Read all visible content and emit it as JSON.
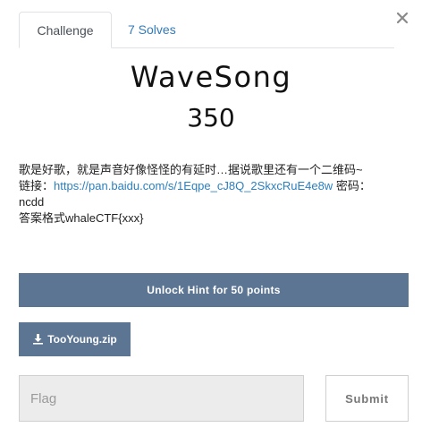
{
  "tabs": [
    {
      "label": "Challenge",
      "active": true
    },
    {
      "label": "7 Solves",
      "active": false
    }
  ],
  "close_icon": "close-icon",
  "challenge": {
    "name": "WaveSong",
    "points": "350",
    "description": {
      "line1": "歌是好歌，就是声音好像怪怪的有延时…据说歌里还有一个二维码~",
      "link_prefix": "链接：",
      "link_text": "https://pan.baidu.com/s/1Eqpe_cJ8Q_2SkxcRuE4e8w",
      "link_suffix": " 密码：",
      "password": "ncdd",
      "format": "答案格式whaleCTF{xxx}"
    }
  },
  "hint_button": {
    "label": "Unlock Hint for 50 points"
  },
  "file_button": {
    "label": "TooYoung.zip",
    "icon": "download-icon"
  },
  "flag_input": {
    "value": "",
    "placeholder": "Flag"
  },
  "submit_button": {
    "label": "Submit"
  },
  "colors": {
    "button_bg": "#5c7593",
    "link": "#2a7fbf",
    "input_bg": "#ececec"
  }
}
